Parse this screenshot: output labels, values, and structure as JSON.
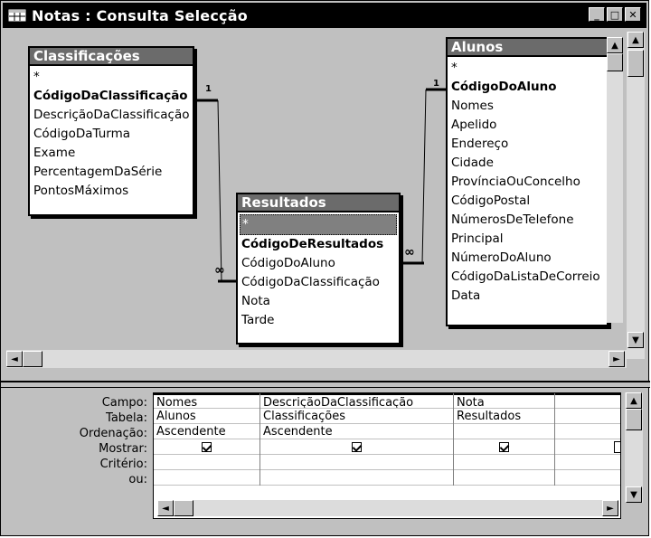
{
  "window": {
    "title": "Notas : Consulta Selecção"
  },
  "title_buttons": {
    "minimize": "_",
    "maximize": "□",
    "close": "✕"
  },
  "tables": {
    "classificacoes": {
      "name": "Classificações",
      "fields": [
        "*",
        "CódigoDaClassificação",
        "DescriçãoDaClassificação",
        "CódigoDaTurma",
        "Exame",
        "PercentagemDaSérie",
        "PontosMáximos"
      ]
    },
    "resultados": {
      "name": "Resultados",
      "fields": [
        "*",
        "CódigoDeResultados",
        "CódigoDoAluno",
        "CódigoDaClassificação",
        "Nota",
        "Tarde"
      ]
    },
    "alunos": {
      "name": "Alunos",
      "fields": [
        "*",
        "CódigoDoAluno",
        "Nomes",
        "Apelido",
        "Endereço",
        "Cidade",
        "ProvínciaOuConcelho",
        "CódigoPostal",
        "NúmerosDeTelefone",
        "Principal",
        "NúmeroDoAluno",
        "CódigoDaListaDeCorreio",
        "Data"
      ]
    }
  },
  "relations": {
    "left_one": "1",
    "left_many": "∞",
    "right_one": "1",
    "right_many": "∞"
  },
  "grid": {
    "row_labels": [
      "Campo:",
      "Tabela:",
      "Ordenação:",
      "Mostrar:",
      "Critério:",
      "ou:"
    ],
    "columns": [
      {
        "campo": "Nomes",
        "tabela": "Alunos",
        "ordenacao": "Ascendente",
        "mostrar": true
      },
      {
        "campo": "DescriçãoDaClassificação",
        "tabela": "Classificações",
        "ordenacao": "Ascendente",
        "mostrar": true
      },
      {
        "campo": "Nota",
        "tabela": "Resultados",
        "ordenacao": "",
        "mostrar": true
      },
      {
        "campo": "",
        "tabela": "",
        "ordenacao": "",
        "mostrar": false
      }
    ]
  },
  "scroll_glyphs": {
    "up": "▲",
    "down": "▼",
    "left": "◄",
    "right": "►"
  }
}
